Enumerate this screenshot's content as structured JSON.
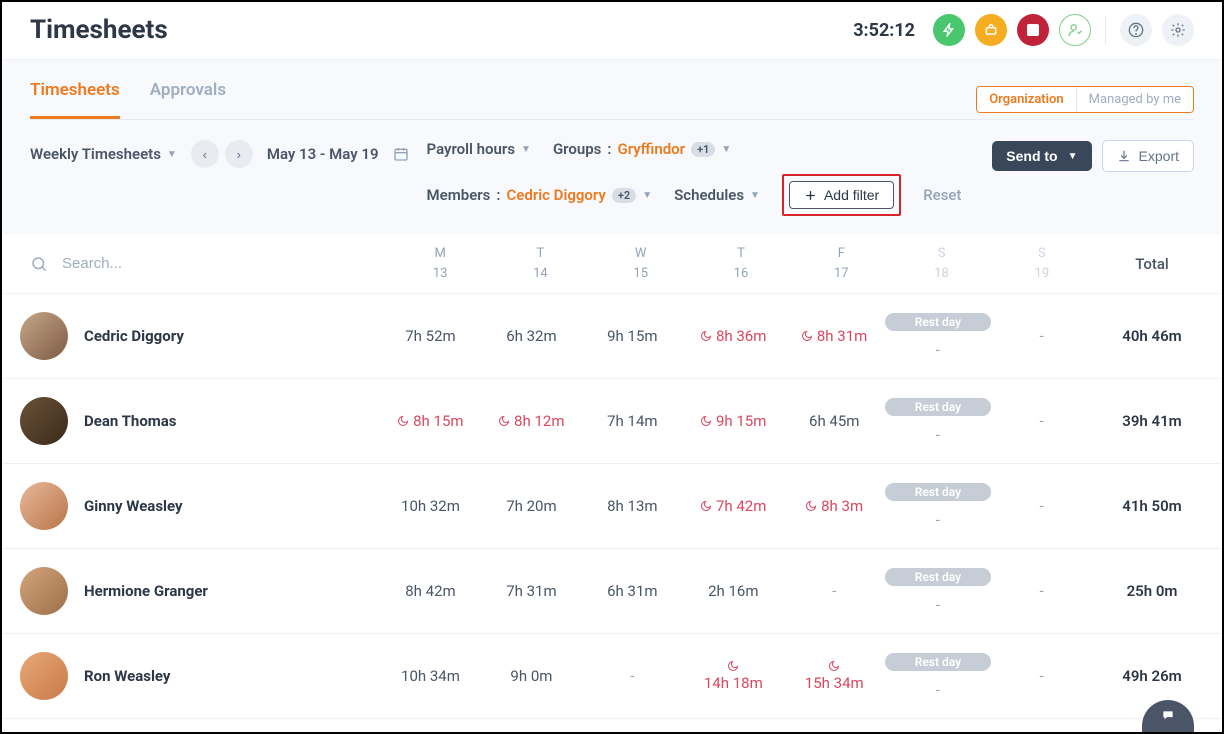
{
  "header": {
    "title": "Timesheets",
    "timer": "3:52:12"
  },
  "tabs": {
    "items": [
      {
        "label": "Timesheets",
        "active": true
      },
      {
        "label": "Approvals",
        "active": false
      }
    ]
  },
  "segToggle": {
    "org": "Organization",
    "managed": "Managed by me"
  },
  "filters": {
    "viewLabel": "Weekly Timesheets",
    "dateRange": "May 13 - May 19",
    "payroll": "Payroll hours",
    "groupsLabel": "Groups",
    "groupsValue": "Gryffindor",
    "groupsExtra": "+1",
    "membersLabel": "Members",
    "membersValue": "Cedric Diggory",
    "membersExtra": "+2",
    "schedules": "Schedules",
    "addFilter": "Add filter",
    "reset": "Reset",
    "sendTo": "Send to",
    "export": "Export"
  },
  "table": {
    "searchPlaceholder": "Search...",
    "days": [
      {
        "dow": "M",
        "num": "13",
        "weekend": false
      },
      {
        "dow": "T",
        "num": "14",
        "weekend": false
      },
      {
        "dow": "W",
        "num": "15",
        "weekend": false
      },
      {
        "dow": "T",
        "num": "16",
        "weekend": false
      },
      {
        "dow": "F",
        "num": "17",
        "weekend": false
      },
      {
        "dow": "S",
        "num": "18",
        "weekend": true
      },
      {
        "dow": "S",
        "num": "19",
        "weekend": true
      }
    ],
    "totalLabel": "Total",
    "restLabel": "Rest day",
    "rows": [
      {
        "name": "Cedric Diggory",
        "avatarColor": "linear-gradient(135deg,#c7a889,#7c5a44)",
        "cells": [
          {
            "v": "7h 52m",
            "flag": false
          },
          {
            "v": "6h 32m",
            "flag": false
          },
          {
            "v": "9h 15m",
            "flag": false
          },
          {
            "v": "8h 36m",
            "flag": true
          },
          {
            "v": "8h 31m",
            "flag": true
          },
          {
            "v": "-",
            "rest": true
          },
          {
            "v": "-",
            "rest": false
          }
        ],
        "total": "40h 46m"
      },
      {
        "name": "Dean Thomas",
        "avatarColor": "linear-gradient(135deg,#6b5238,#3a2a1a)",
        "cells": [
          {
            "v": "8h 15m",
            "flag": true
          },
          {
            "v": "8h 12m",
            "flag": true
          },
          {
            "v": "7h 14m",
            "flag": false
          },
          {
            "v": "9h 15m",
            "flag": true
          },
          {
            "v": "6h 45m",
            "flag": false
          },
          {
            "v": "-",
            "rest": true
          },
          {
            "v": "-",
            "rest": false
          }
        ],
        "total": "39h 41m"
      },
      {
        "name": "Ginny Weasley",
        "avatarColor": "linear-gradient(135deg,#e8b89a,#b87548)",
        "cells": [
          {
            "v": "10h 32m",
            "flag": false
          },
          {
            "v": "7h 20m",
            "flag": false
          },
          {
            "v": "8h 13m",
            "flag": false
          },
          {
            "v": "7h 42m",
            "flag": true
          },
          {
            "v": "8h 3m",
            "flag": true
          },
          {
            "v": "-",
            "rest": true
          },
          {
            "v": "-",
            "rest": false
          }
        ],
        "total": "41h 50m"
      },
      {
        "name": "Hermione Granger",
        "avatarColor": "linear-gradient(135deg,#d4a57c,#9c6f4a)",
        "cells": [
          {
            "v": "8h 42m",
            "flag": false
          },
          {
            "v": "7h 31m",
            "flag": false
          },
          {
            "v": "6h 31m",
            "flag": false
          },
          {
            "v": "2h 16m",
            "flag": false
          },
          {
            "v": "-",
            "flag": false
          },
          {
            "v": "-",
            "rest": true
          },
          {
            "v": "-",
            "rest": false
          }
        ],
        "total": "25h 0m"
      },
      {
        "name": "Ron Weasley",
        "avatarColor": "linear-gradient(135deg,#e8a878,#c97a48)",
        "cells": [
          {
            "v": "10h 34m",
            "flag": false
          },
          {
            "v": "9h 0m",
            "flag": false
          },
          {
            "v": "-",
            "flag": false
          },
          {
            "v": "14h 18m",
            "flag": true,
            "stacked": true
          },
          {
            "v": "15h 34m",
            "flag": true,
            "stacked": true
          },
          {
            "v": "-",
            "rest": true
          },
          {
            "v": "-",
            "rest": false
          }
        ],
        "total": "49h 26m"
      }
    ]
  }
}
